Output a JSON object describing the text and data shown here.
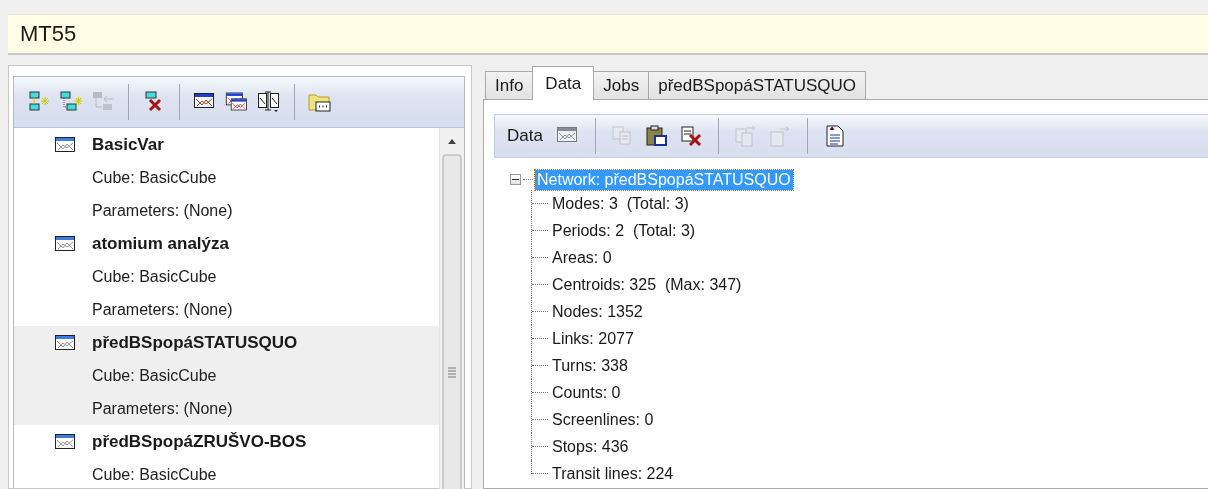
{
  "window": {
    "title": "MT55"
  },
  "left_toolbar": [
    {
      "kind": "add",
      "disabled": false
    },
    {
      "kind": "add-child",
      "disabled": false
    },
    {
      "kind": "move",
      "disabled": true
    },
    {
      "kind": "separator"
    },
    {
      "kind": "delete",
      "disabled": false
    },
    {
      "kind": "separator"
    },
    {
      "kind": "grid",
      "disabled": false
    },
    {
      "kind": "grid-copy",
      "disabled": false
    },
    {
      "kind": "grid-split",
      "disabled": false
    },
    {
      "kind": "separator"
    },
    {
      "kind": "folder",
      "disabled": false
    }
  ],
  "scenarios": [
    {
      "name": "BasicVar",
      "cube": "Cube: BasicCube",
      "parameters": "Parameters: (None)",
      "selected": false
    },
    {
      "name": "atomium analýza",
      "cube": "Cube: BasicCube",
      "parameters": "Parameters: (None)",
      "selected": false
    },
    {
      "name": "předBSpopáSTATUSQUO",
      "cube": "Cube: BasicCube",
      "parameters": "Parameters: (None)",
      "selected": true
    },
    {
      "name": "předBSpopáZRUŠVO-BOS",
      "cube": "Cube: BasicCube",
      "selected": false
    }
  ],
  "tabs": [
    {
      "label": "Info",
      "selected": false
    },
    {
      "label": "Data",
      "selected": true
    },
    {
      "label": "Jobs",
      "selected": false
    },
    {
      "label": "předBSpopáSTATUSQUO",
      "selected": false
    }
  ],
  "data_toolbar": {
    "label": "Data",
    "buttons": [
      {
        "kind": "grid",
        "disabled": true
      },
      {
        "kind": "separator"
      },
      {
        "kind": "copy",
        "disabled": true
      },
      {
        "kind": "paste",
        "disabled": false
      },
      {
        "kind": "delete",
        "disabled": false
      },
      {
        "kind": "separator"
      },
      {
        "kind": "copy-to",
        "disabled": true
      },
      {
        "kind": "export",
        "disabled": true
      },
      {
        "kind": "separator"
      },
      {
        "kind": "report",
        "disabled": false
      }
    ]
  },
  "tree": [
    {
      "label": "Network: předBSpopáSTATUSQUO",
      "selected": true,
      "expanded": true,
      "children": [
        {
          "label": "Modes: 3  (Total: 3)"
        },
        {
          "label": "Periods: 2  (Total: 3)"
        },
        {
          "label": "Areas: 0"
        },
        {
          "label": "Centroids: 325  (Max: 347)"
        },
        {
          "label": "Nodes: 1352"
        },
        {
          "label": "Links: 2077"
        },
        {
          "label": "Turns: 338"
        },
        {
          "label": "Counts: 0"
        },
        {
          "label": "Screenlines: 0"
        },
        {
          "label": "Stops: 436"
        },
        {
          "label": "Transit lines: 224"
        }
      ]
    }
  ]
}
